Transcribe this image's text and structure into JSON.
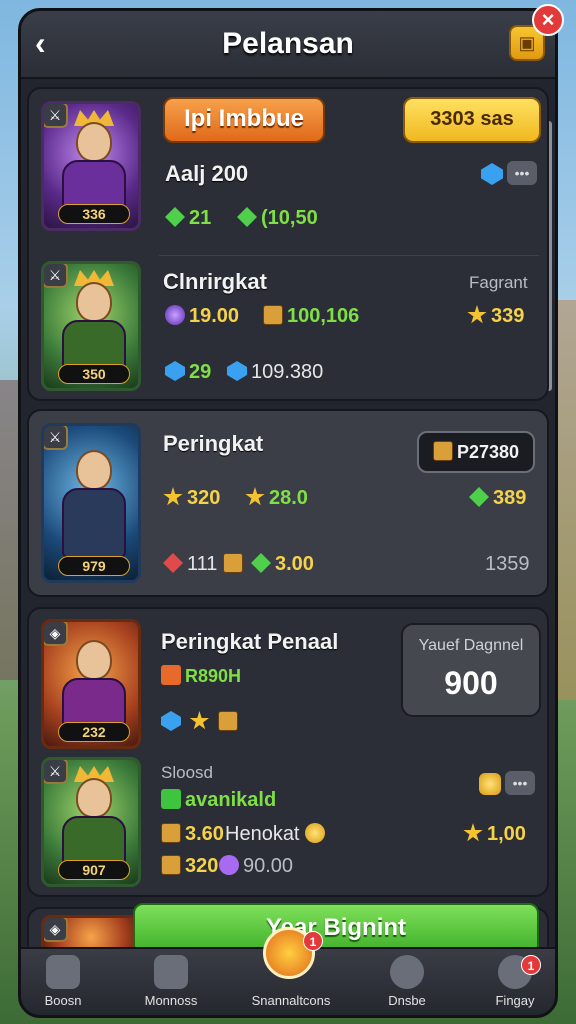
{
  "header": {
    "title": "Pelansan",
    "back_icon": "back-arrow-icon",
    "corner_icon": "shop-icon",
    "close_icon": "close-icon"
  },
  "cards": [
    {
      "name": "Aalj 200",
      "level": "336",
      "primary_button": "Ipi Imbbue",
      "secondary_button": "3303 sas",
      "stats": [
        {
          "icon": "gem-green",
          "value": "21"
        },
        {
          "icon": "gem-green",
          "value": "(10,50"
        }
      ]
    },
    {
      "name": "Clnrirgkat",
      "level": "350",
      "side_label": "Fagrant",
      "side_value": "339",
      "stats_row1": [
        {
          "icon": "orb-purple",
          "value": "19.00"
        },
        {
          "icon": "chest",
          "value": "100,106"
        }
      ],
      "stats_row2": [
        {
          "icon": "gem-blue",
          "value": "29"
        },
        {
          "icon": "gem-blue",
          "value": "109.380"
        }
      ]
    },
    {
      "name": "Peringkat",
      "level": "979",
      "pill": "P27380",
      "stats_row1": [
        {
          "icon": "star",
          "value": "320"
        },
        {
          "icon": "star",
          "value": "28.0"
        }
      ],
      "side_value1": "389",
      "stats_row2": [
        {
          "icon": "ruby",
          "value": "111"
        },
        {
          "icon": "chest",
          "value": ""
        },
        {
          "icon": "gem-green",
          "value": "3.00"
        }
      ],
      "side_value2": "1359"
    },
    {
      "name": "Peringkat Penaal",
      "level": "232",
      "tag": "R890H",
      "price_label": "Yauef Dagnnel",
      "price_value": "900",
      "subname": "Sloosd",
      "tag2": "avanikald",
      "level2": "907",
      "row1_value": "3.60",
      "row1_label": "Henokat",
      "row1_side": "1,00",
      "row2_value1": "320",
      "row2_value2": "90.00"
    }
  ],
  "cta_button": "Year Bignint",
  "nav": [
    {
      "label": "Boosn",
      "icon": "castle-icon"
    },
    {
      "label": "Monnoss",
      "icon": "lock-icon"
    },
    {
      "label": "Snannaltcons",
      "icon": "chest-icon",
      "badge": "1"
    },
    {
      "label": "Dnsbe",
      "icon": "swirl-icon"
    },
    {
      "label": "Fingay",
      "icon": "settings-icon",
      "badge": "1"
    }
  ]
}
